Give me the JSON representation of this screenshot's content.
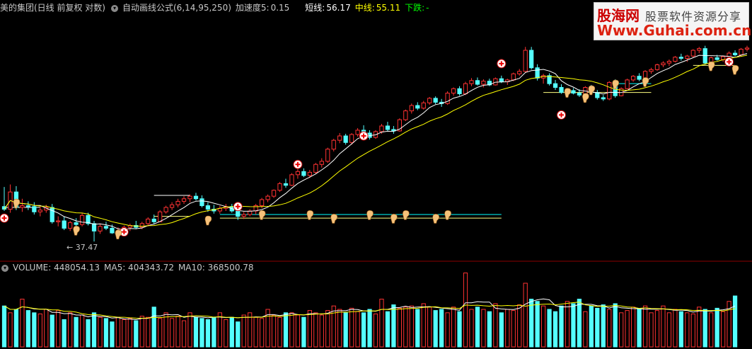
{
  "header": {
    "title": "美的集团(日线 前复权 对数)",
    "formula": "自动画线公式(6,14,95,250)",
    "accel_label": "加速度5:",
    "accel_value": "0.15",
    "short_label": "短线:",
    "short_value": "56.17",
    "mid_label": "中线:",
    "mid_value": "55.11",
    "trend": "下跌:",
    "trend_value": "-"
  },
  "volume_header": {
    "vol": "VOLUME: 448054.13",
    "ma5": "MA5: 404343.72",
    "ma10": "MA10: 368500.78"
  },
  "logo": {
    "brand": "股海网",
    "tagline": "股票软件资源分享",
    "url": "Www.Guhai.com.cn"
  },
  "annotation": {
    "low_label": "← 37.47"
  },
  "colors": {
    "up": "#ff3232",
    "down": "#54ffff",
    "short_ma": "#ffffff",
    "mid_ma": "#ffff00",
    "support": "#00ffff"
  },
  "chart_data": {
    "type": "candlestick",
    "price_scale": "log",
    "price_low_marked": 37.47,
    "candles": [
      [
        41.3,
        43.6,
        40.8,
        41.0
      ],
      [
        41.0,
        43.9,
        40.6,
        43.0
      ],
      [
        43.0,
        43.7,
        40.9,
        41.2
      ],
      [
        41.2,
        42.2,
        40.7,
        41.4
      ],
      [
        41.4,
        41.9,
        40.9,
        41.3
      ],
      [
        41.3,
        41.8,
        40.4,
        40.7
      ],
      [
        40.7,
        41.3,
        40.2,
        40.9
      ],
      [
        40.9,
        41.5,
        40.6,
        41.2
      ],
      [
        41.2,
        41.6,
        39.4,
        39.6
      ],
      [
        39.6,
        40.2,
        39.1,
        39.7
      ],
      [
        39.7,
        40.2,
        38.7,
        38.9
      ],
      [
        38.9,
        39.7,
        38.6,
        39.5
      ],
      [
        39.5,
        40.0,
        38.9,
        39.3
      ],
      [
        39.3,
        40.6,
        39.1,
        40.3
      ],
      [
        40.3,
        40.6,
        39.2,
        39.4
      ],
      [
        39.4,
        39.7,
        37.5,
        38.6
      ],
      [
        38.6,
        39.4,
        38.3,
        39.1
      ],
      [
        39.1,
        39.6,
        38.7,
        38.9
      ],
      [
        38.9,
        39.3,
        38.3,
        38.4
      ],
      [
        38.4,
        39.0,
        38.1,
        38.6
      ],
      [
        38.6,
        39.2,
        38.3,
        39.0
      ],
      [
        39.0,
        39.4,
        38.6,
        39.2
      ],
      [
        39.2,
        39.7,
        38.8,
        39.0
      ],
      [
        39.0,
        39.6,
        38.8,
        39.4
      ],
      [
        39.4,
        40.1,
        39.1,
        39.9
      ],
      [
        39.9,
        40.4,
        39.4,
        39.6
      ],
      [
        39.6,
        40.9,
        39.6,
        40.7
      ],
      [
        40.7,
        41.4,
        40.5,
        41.2
      ],
      [
        41.2,
        41.8,
        40.9,
        41.5
      ],
      [
        41.5,
        42.2,
        41.2,
        41.9
      ],
      [
        41.9,
        42.5,
        41.6,
        42.2
      ],
      [
        42.2,
        42.7,
        41.8,
        42.5
      ],
      [
        42.5,
        42.9,
        42.0,
        42.2
      ],
      [
        42.2,
        42.6,
        41.2,
        41.4
      ],
      [
        41.4,
        41.8,
        40.7,
        41.0
      ],
      [
        41.0,
        41.5,
        40.5,
        40.8
      ],
      [
        40.8,
        41.4,
        40.5,
        41.1
      ],
      [
        41.1,
        41.6,
        40.8,
        41.3
      ],
      [
        41.3,
        41.6,
        40.6,
        40.8
      ],
      [
        40.8,
        41.2,
        39.8,
        40.2
      ],
      [
        40.2,
        40.7,
        39.9,
        40.4
      ],
      [
        40.4,
        41.0,
        40.2,
        40.8
      ],
      [
        40.8,
        41.6,
        40.4,
        41.4
      ],
      [
        41.4,
        42.3,
        41.1,
        42.1
      ],
      [
        42.1,
        42.7,
        41.8,
        42.5
      ],
      [
        42.5,
        43.3,
        42.3,
        43.2
      ],
      [
        43.2,
        44.2,
        43.0,
        44.0
      ],
      [
        44.0,
        44.6,
        43.5,
        43.8
      ],
      [
        43.8,
        45.3,
        43.7,
        45.1
      ],
      [
        45.1,
        45.8,
        44.6,
        45.5
      ],
      [
        45.5,
        45.9,
        44.8,
        45.0
      ],
      [
        45.0,
        45.7,
        44.7,
        45.4
      ],
      [
        45.4,
        46.6,
        45.2,
        46.4
      ],
      [
        46.4,
        47.2,
        46.0,
        46.8
      ],
      [
        46.8,
        48.6,
        46.6,
        48.4
      ],
      [
        48.4,
        49.8,
        48.1,
        49.6
      ],
      [
        49.6,
        50.6,
        49.2,
        50.2
      ],
      [
        50.2,
        50.5,
        49.0,
        49.3
      ],
      [
        49.3,
        50.6,
        49.0,
        50.4
      ],
      [
        50.4,
        51.3,
        50.1,
        51.0
      ],
      [
        51.0,
        51.7,
        50.3,
        50.6
      ],
      [
        50.6,
        51.0,
        49.7,
        50.0
      ],
      [
        50.0,
        51.0,
        49.8,
        50.8
      ],
      [
        50.8,
        51.9,
        50.5,
        51.6
      ],
      [
        51.6,
        52.2,
        50.8,
        51.1
      ],
      [
        51.1,
        51.6,
        50.5,
        50.9
      ],
      [
        50.9,
        52.7,
        50.8,
        52.5
      ],
      [
        52.5,
        54.0,
        52.3,
        53.8
      ],
      [
        53.8,
        54.9,
        53.4,
        54.6
      ],
      [
        54.6,
        55.1,
        53.9,
        54.2
      ],
      [
        54.2,
        55.3,
        54.0,
        55.0
      ],
      [
        55.0,
        55.9,
        54.7,
        55.7
      ],
      [
        55.7,
        56.0,
        54.8,
        55.1
      ],
      [
        55.1,
        55.6,
        54.4,
        54.9
      ],
      [
        54.9,
        56.8,
        54.7,
        56.5
      ],
      [
        56.5,
        57.4,
        56.1,
        57.2
      ],
      [
        57.2,
        57.6,
        56.1,
        56.4
      ],
      [
        56.4,
        58.3,
        56.2,
        58.0
      ],
      [
        58.0,
        58.9,
        57.6,
        58.5
      ],
      [
        58.5,
        59.0,
        57.7,
        57.9
      ],
      [
        57.9,
        58.7,
        57.4,
        58.4
      ],
      [
        58.4,
        58.8,
        57.6,
        57.8
      ],
      [
        57.8,
        59.0,
        57.7,
        58.8
      ],
      [
        58.8,
        59.3,
        58.1,
        58.3
      ],
      [
        58.3,
        58.8,
        57.8,
        58.6
      ],
      [
        58.6,
        59.8,
        58.4,
        59.6
      ],
      [
        59.6,
        60.4,
        59.3,
        60.0
      ],
      [
        60.0,
        64.2,
        59.8,
        63.6
      ],
      [
        63.6,
        64.2,
        60.3,
        60.6
      ],
      [
        60.6,
        61.2,
        58.5,
        58.9
      ],
      [
        58.9,
        59.6,
        58.0,
        59.3
      ],
      [
        59.3,
        59.7,
        57.7,
        58.0
      ],
      [
        58.0,
        58.6,
        57.0,
        57.4
      ],
      [
        57.4,
        57.9,
        56.4,
        56.6
      ],
      [
        56.6,
        57.2,
        56.2,
        56.9
      ],
      [
        56.9,
        57.3,
        56.3,
        56.5
      ],
      [
        56.5,
        57.1,
        55.9,
        56.2
      ],
      [
        56.2,
        57.6,
        56.0,
        57.4
      ],
      [
        57.4,
        57.8,
        56.4,
        56.6
      ],
      [
        56.6,
        57.0,
        55.5,
        55.8
      ],
      [
        55.8,
        56.2,
        55.3,
        55.6
      ],
      [
        55.6,
        58.4,
        55.4,
        58.2
      ],
      [
        58.2,
        58.7,
        55.8,
        56.1
      ],
      [
        56.1,
        57.4,
        56.0,
        57.2
      ],
      [
        57.2,
        58.8,
        57.1,
        58.6
      ],
      [
        58.6,
        59.4,
        58.3,
        59.2
      ],
      [
        59.2,
        59.7,
        58.4,
        58.7
      ],
      [
        58.7,
        60.2,
        58.5,
        60.0
      ],
      [
        60.0,
        60.6,
        59.6,
        60.3
      ],
      [
        60.3,
        61.3,
        60.1,
        61.1
      ],
      [
        61.1,
        61.7,
        60.7,
        61.4
      ],
      [
        61.4,
        62.0,
        60.9,
        61.7
      ],
      [
        61.7,
        62.6,
        61.5,
        62.4
      ],
      [
        62.4,
        63.0,
        61.8,
        62.2
      ],
      [
        62.2,
        62.8,
        61.6,
        62.6
      ],
      [
        62.6,
        63.8,
        62.4,
        63.6
      ],
      [
        63.6,
        64.2,
        63.1,
        63.9
      ],
      [
        63.9,
        64.4,
        61.1,
        61.4
      ],
      [
        61.4,
        62.5,
        61.2,
        62.3
      ],
      [
        62.3,
        62.8,
        61.8,
        62.0
      ],
      [
        62.0,
        62.7,
        61.6,
        62.5
      ],
      [
        62.5,
        63.4,
        62.2,
        63.1
      ],
      [
        63.1,
        63.6,
        62.5,
        62.8
      ],
      [
        62.8,
        64.0,
        62.6,
        63.8
      ],
      [
        63.8,
        64.4,
        63.4,
        64.0
      ]
    ],
    "volume": [
      360000,
      300000,
      330000,
      420000,
      320000,
      300000,
      290000,
      330000,
      280000,
      320000,
      240000,
      300000,
      260000,
      280000,
      240000,
      300000,
      260000,
      250000,
      220000,
      260000,
      240000,
      250000,
      230000,
      270000,
      260000,
      350000,
      250000,
      300000,
      250000,
      270000,
      230000,
      300000,
      260000,
      250000,
      240000,
      260000,
      300000,
      240000,
      260000,
      220000,
      280000,
      300000,
      260000,
      250000,
      330000,
      280000,
      260000,
      300000,
      300000,
      280000,
      260000,
      320000,
      300000,
      280000,
      320000,
      360000,
      330000,
      300000,
      340000,
      310000,
      300000,
      330000,
      290000,
      420000,
      310000,
      370000,
      340000,
      350000,
      360000,
      330000,
      380000,
      350000,
      320000,
      330000,
      300000,
      350000,
      310000,
      650000,
      330000,
      350000,
      330000,
      310000,
      380000,
      300000,
      330000,
      320000,
      370000,
      560000,
      420000,
      400000,
      360000,
      330000,
      310000,
      360000,
      400000,
      380000,
      420000,
      310000,
      360000,
      340000,
      370000,
      330000,
      380000,
      300000,
      320000,
      350000,
      330000,
      360000,
      300000,
      320000,
      360000,
      300000,
      330000,
      310000,
      300000,
      290000,
      350000,
      330000,
      300000,
      340000,
      310000,
      400000,
      448054
    ],
    "ma5_last": 404343.72,
    "ma10_last": 368500.78
  }
}
